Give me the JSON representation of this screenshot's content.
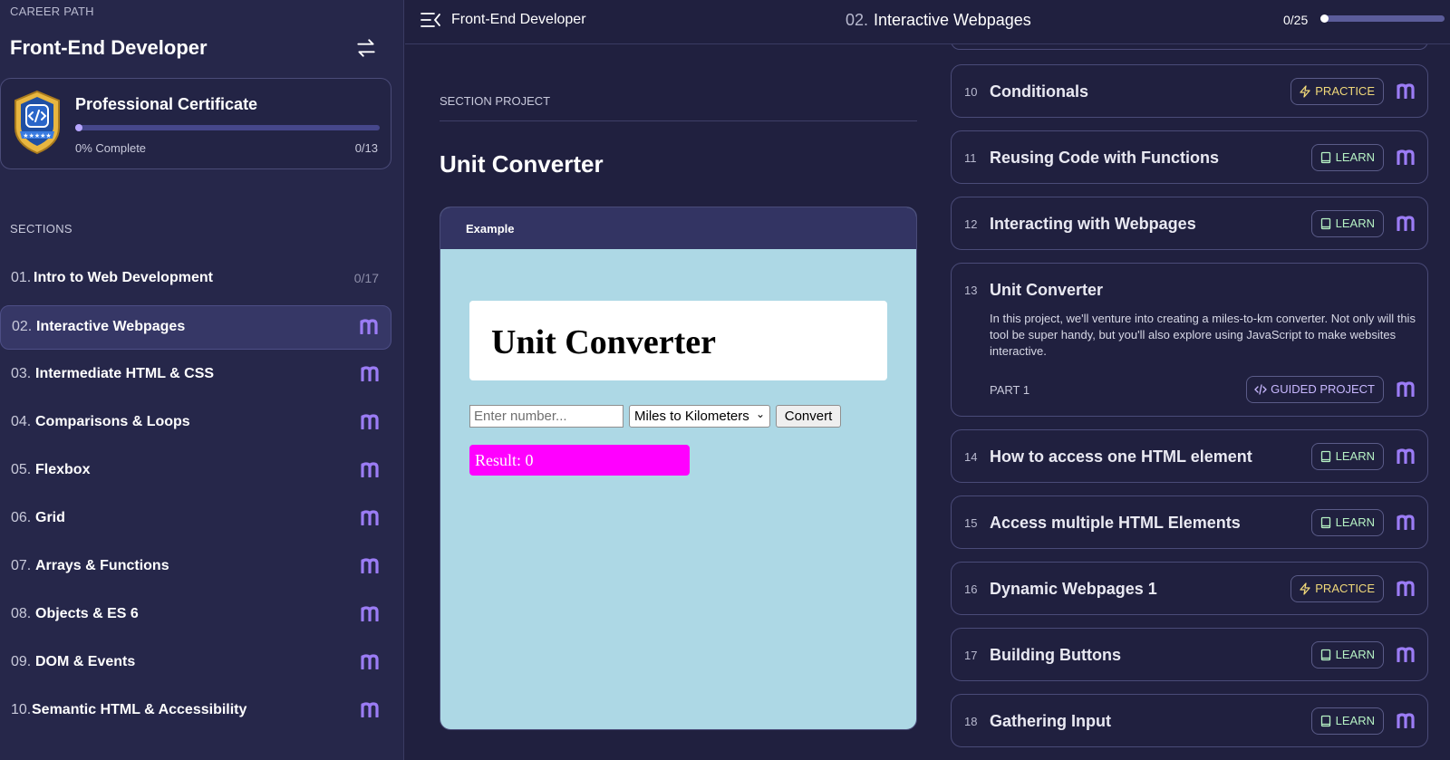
{
  "sidebar": {
    "eyebrow": "CAREER PATH",
    "path_title": "Front-End Developer",
    "certificate": {
      "title": "Professional Certificate",
      "percent_label": "0% Complete",
      "count": "0/13",
      "progress": 0
    },
    "sections_label": "SECTIONS",
    "sections": [
      {
        "num": "01.",
        "name": "Intro to Web Development",
        "count": "0/17"
      },
      {
        "num": "02.",
        "name": "Interactive Webpages",
        "active": true
      },
      {
        "num": "03.",
        "name": "Intermediate HTML & CSS"
      },
      {
        "num": "04.",
        "name": "Comparisons & Loops"
      },
      {
        "num": "05.",
        "name": "Flexbox"
      },
      {
        "num": "06.",
        "name": "Grid"
      },
      {
        "num": "07.",
        "name": "Arrays & Functions"
      },
      {
        "num": "08.",
        "name": "Objects & ES 6"
      },
      {
        "num": "09.",
        "name": "DOM & Events"
      },
      {
        "num": "10.",
        "name": "Semantic HTML & Accessibility"
      }
    ]
  },
  "topbar": {
    "course": "Front-End Developer",
    "section_num": "02.",
    "section_name": "Interactive Webpages",
    "progress_text": "0/25",
    "progress": 0
  },
  "main": {
    "section_project_label": "SECTION PROJECT",
    "project_title": "Unit Converter",
    "example": {
      "label": "Example",
      "demo_title": "Unit Converter",
      "input_placeholder": "Enter number...",
      "select_value": "Miles to Kilometers",
      "button_label": "Convert",
      "result": "Result: 0"
    }
  },
  "lessons": [
    {
      "num": "10",
      "title": "Conditionals",
      "tag": "PRACTICE",
      "kind": "practice"
    },
    {
      "num": "11",
      "title": "Reusing Code with Functions",
      "tag": "LEARN",
      "kind": "learn"
    },
    {
      "num": "12",
      "title": "Interacting with Webpages",
      "tag": "LEARN",
      "kind": "learn"
    },
    {
      "num": "13",
      "title": "Unit Converter",
      "description": "In this project, we'll venture into creating a miles-to-km converter. Not only will this tool be super handy, but you'll also explore using JavaScript to make websites interactive.",
      "part": "PART 1",
      "tag": "GUIDED PROJECT",
      "kind": "guided"
    },
    {
      "num": "14",
      "title": "How to access one HTML element",
      "tag": "LEARN",
      "kind": "learn"
    },
    {
      "num": "15",
      "title": "Access multiple HTML Elements",
      "tag": "LEARN",
      "kind": "learn"
    },
    {
      "num": "16",
      "title": "Dynamic Webpages 1",
      "tag": "PRACTICE",
      "kind": "practice"
    },
    {
      "num": "17",
      "title": "Building Buttons",
      "tag": "LEARN",
      "kind": "learn"
    },
    {
      "num": "18",
      "title": "Gathering Input",
      "tag": "LEARN",
      "kind": "learn"
    }
  ],
  "colors": {
    "background": "#20203f",
    "sidebar": "#26274a",
    "accent": "#b7a6ff",
    "practice": "#f1d97a",
    "learn": "#b6f2c4",
    "example_bg": "#add8e5",
    "result_bg": "#ff00ff"
  },
  "icons": {
    "swap": "swap-arrows-icon",
    "menu": "collapse-menu-icon",
    "badge": "certificate-badge-icon",
    "brand": "scrimba-m-icon",
    "practice": "lightning-icon",
    "learn": "book-icon",
    "guided": "code-brackets-icon"
  }
}
